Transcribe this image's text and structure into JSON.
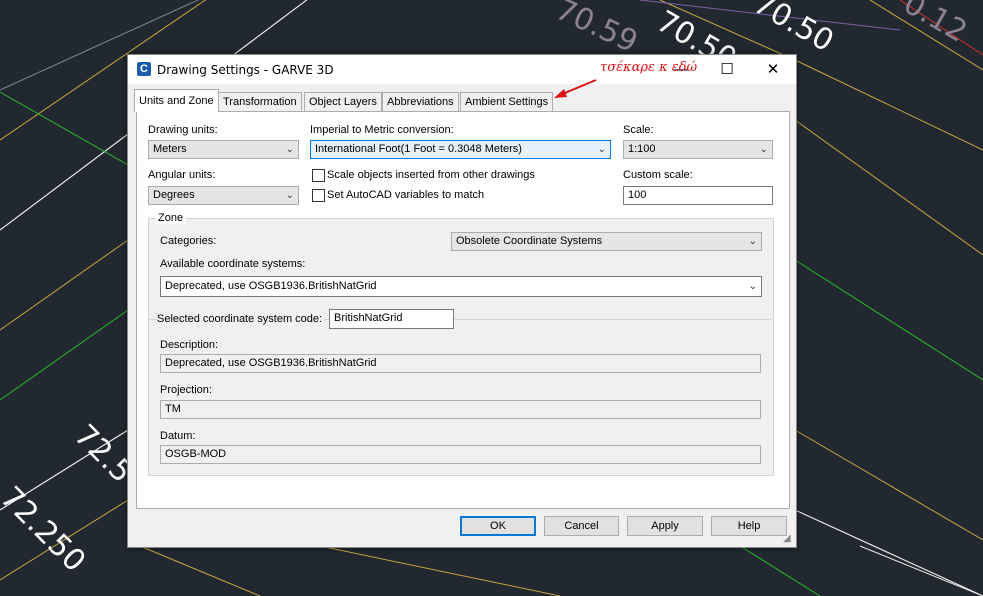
{
  "background": {
    "labels": [
      "70.59",
      "70.50",
      "70.50",
      "0.12",
      "72.5",
      "72.250"
    ]
  },
  "dialog": {
    "title": "Drawing Settings - GARVE 3D",
    "app_icon": "C",
    "minimize_glyph": "—",
    "maximize_glyph": "☐",
    "close_glyph": "✕",
    "tabs": [
      {
        "label": "Units and Zone",
        "active": true
      },
      {
        "label": "Transformation",
        "active": false
      },
      {
        "label": "Object Layers",
        "active": false
      },
      {
        "label": "Abbreviations",
        "active": false
      },
      {
        "label": "Ambient Settings",
        "active": false
      }
    ],
    "drawing_units": {
      "label": "Drawing units:",
      "value": "Meters"
    },
    "angular_units": {
      "label": "Angular units:",
      "value": "Degrees"
    },
    "imperial_conversion": {
      "label": "Imperial to Metric conversion:",
      "value": "International Foot(1 Foot = 0.3048 Meters)"
    },
    "scale_objects": {
      "label": "Scale objects inserted from other drawings",
      "checked": false
    },
    "set_autocad_vars": {
      "label": "Set AutoCAD variables to match",
      "checked": false
    },
    "scale": {
      "label": "Scale:",
      "value": "1:100"
    },
    "custom_scale": {
      "label": "Custom scale:",
      "value": "100"
    },
    "zone": {
      "title": "Zone",
      "categories_label": "Categories:",
      "categories_value": "Obsolete Coordinate Systems",
      "available_label": "Available coordinate systems:",
      "available_value": "Deprecated, use OSGB1936.BritishNatGrid",
      "code_label": "Selected coordinate system code:",
      "code_value": "BritishNatGrid",
      "description_label": "Description:",
      "description_value": "Deprecated, use OSGB1936.BritishNatGrid",
      "projection_label": "Projection:",
      "projection_value": "TM",
      "datum_label": "Datum:",
      "datum_value": "OSGB-MOD"
    },
    "buttons": {
      "ok": "OK",
      "cancel": "Cancel",
      "apply": "Apply",
      "help": "Help"
    }
  },
  "annotation": {
    "text": "τσέκαρε κ εδώ",
    "color": "#e01010"
  }
}
